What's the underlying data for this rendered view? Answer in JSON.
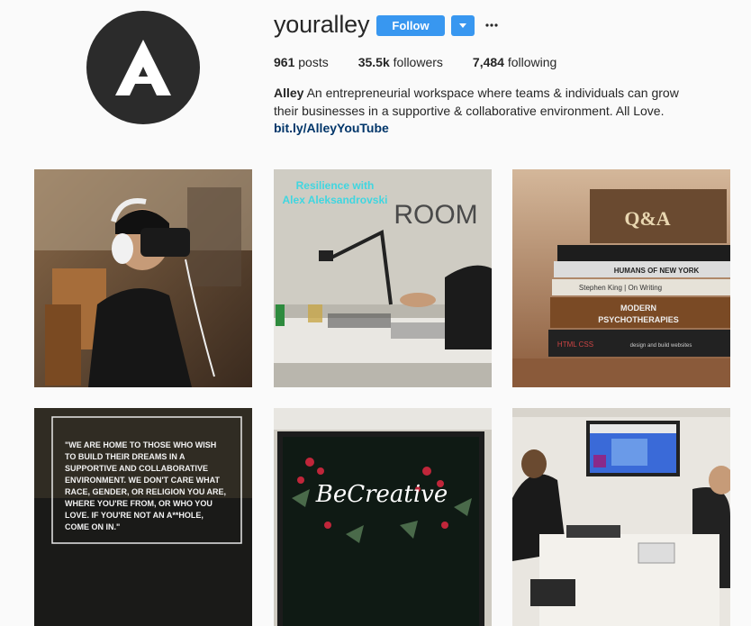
{
  "profile": {
    "username": "youralley",
    "follow_label": "Follow",
    "more_label": "···",
    "stats": {
      "posts_count": "961",
      "posts_label": "posts",
      "followers_count": "35.5k",
      "followers_label": "followers",
      "following_count": "7,484",
      "following_label": "following"
    },
    "bio_name": "Alley",
    "bio_text": "An entrepreneurial workspace where teams & individuals can grow their businesses in a supportive & collaborative environment. All Love.",
    "bio_link": "bit.ly/AlleyYouTube"
  },
  "posts": {
    "p2_caption_line1": "Resilience with",
    "p2_caption_line2": "Alex Aleksandrovski",
    "p2_sign": "ROOM",
    "p3_book1": "Q&A",
    "p3_book2": "HUMANS OF NEW YORK",
    "p3_book3": "Stephen King | On Writing",
    "p3_book4_line1": "MODERN",
    "p3_book4_line2": "PSYCHOTHERAPIES",
    "p3_book5": "HTML CSS",
    "p3_book5b": "design and build websites",
    "p4_quote": [
      "\"WE ARE HOME TO THOSE WHO WISH",
      "TO BUILD THEIR DREAMS IN A",
      "SUPPORTIVE AND COLLABORATIVE",
      "ENVIRONMENT. WE DON'T CARE WHAT",
      "RACE, GENDER, OR RELIGION YOU ARE,",
      "WHERE YOU'RE FROM, OR WHO YOU",
      "LOVE. IF YOU'RE NOT AN A**HOLE,",
      "COME ON IN.\""
    ],
    "p5_script": "BeCreative"
  }
}
